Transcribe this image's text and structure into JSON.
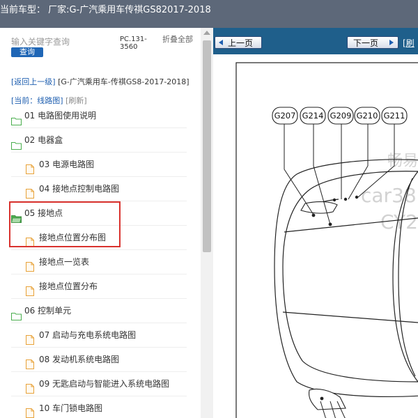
{
  "header": {
    "title": "当前车型： 厂家:G-广汽乘用车传祺GS82017-2018"
  },
  "sidebar": {
    "search_placeholder": "输入关键字查询",
    "search_button": "查询",
    "pc_code": "PC.131-3560",
    "collapse_all": "折叠全部",
    "path_back": "[返回上一级]",
    "path_model": "[G-广汽乘用车-传祺GS8-2017-2018]",
    "current_prefix": "[当前：线路图]",
    "current_refresh": "[刷新]",
    "items": [
      {
        "label": "01 电路图使用说明",
        "type": "folder",
        "level": 0
      },
      {
        "label": "02 电器盒",
        "type": "folder",
        "level": 0
      },
      {
        "label": "03 电源电路图",
        "type": "file",
        "level": 1
      },
      {
        "label": "04 接地点控制电路图",
        "type": "file",
        "level": 1
      },
      {
        "label": "05 接地点",
        "type": "folder-open",
        "level": 0
      },
      {
        "label": "接地点位置分布图",
        "type": "file",
        "level": 1
      },
      {
        "label": "接地点一览表",
        "type": "file",
        "level": 1
      },
      {
        "label": "接地点位置分布",
        "type": "file",
        "level": 1
      },
      {
        "label": "06 控制单元",
        "type": "folder",
        "level": 0
      },
      {
        "label": "07 启动与充电系统电路图",
        "type": "file",
        "level": 1
      },
      {
        "label": "08 发动机系统电路图",
        "type": "file",
        "level": 1
      },
      {
        "label": "09 无匙启动与智能进入系统电路图",
        "type": "file",
        "level": 1
      },
      {
        "label": "10 车门锁电路图",
        "type": "file",
        "level": 1
      }
    ]
  },
  "viewer": {
    "prev_button": "上一页",
    "next_button": "下一页",
    "refresh_link": "[刷",
    "ground_labels": [
      "G207",
      "G214",
      "G209",
      "G210",
      "G211"
    ],
    "watermark": [
      "畅易",
      "car38",
      "CY2"
    ]
  },
  "colors": {
    "topbar": "#5d6879",
    "toolbar": "#1f5f8b",
    "accent": "#1f66b6",
    "highlight": "#d9322e",
    "folder": "#4caf50",
    "file": "#e8a33c"
  },
  "icons": {
    "folder": "folder-icon",
    "folder_open": "folder-open-icon",
    "file": "file-icon"
  }
}
